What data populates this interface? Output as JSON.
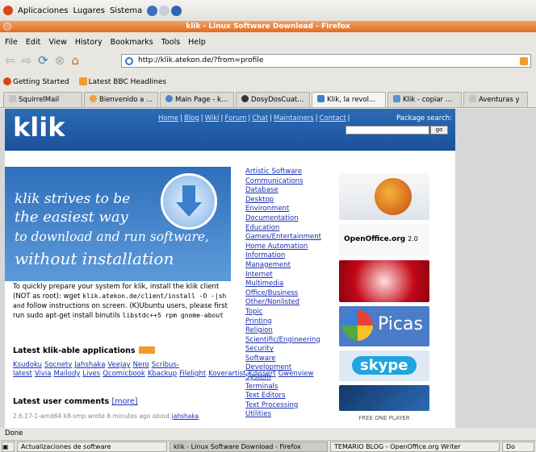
{
  "gnome_panel": {
    "menus": [
      "Aplicaciones",
      "Lugares",
      "Sistema"
    ]
  },
  "window": {
    "title": "klik - Linux Software Download - Firefox"
  },
  "menubar": [
    "File",
    "Edit",
    "View",
    "History",
    "Bookmarks",
    "Tools",
    "Help"
  ],
  "navigation": {
    "url": "http://klik.atekon.de/?from=profile"
  },
  "bookmarks": [
    "Getting Started",
    "Latest BBC Headlines"
  ],
  "tabs": [
    "SquirrelMail",
    "Bienvenido a ...",
    "Main Page - k...",
    "DosyDosCuat...",
    "Klik, la revol...",
    "Klik - copiar ...",
    "Aventuras y"
  ],
  "site": {
    "logo": "klik",
    "nav_links": [
      "Home",
      "Blog",
      "Wiki",
      "Forum",
      "Chat",
      "Maintainers",
      "Contact"
    ],
    "search_label": "Package search:",
    "go_label": "go",
    "banner_lines": [
      "klik strives to be",
      "the easiest way",
      "to download and run software,",
      "without installation"
    ],
    "intro_text": "To quickly prepare your system for klik, install the klik client (NOT as root): wget",
    "intro_code": "klik.atekon.de/client/install -O -|sh and",
    "intro_text2": "follow instructions on screen. (K)Ubuntu users, please first run sudo apt-get install binutils",
    "intro_code2": "libstdc++5 rpm gnome-about",
    "latest_apps_heading": "Latest klik-able applications",
    "latest_apps": [
      "Ksudoku",
      "Socnetv",
      "Jahshaka",
      "Veejay",
      "Nero",
      "Scribus-latest",
      "Vivia",
      "Mailody",
      "Lives",
      "Qcomicbook",
      "Kbackup",
      "Filelight",
      "Koverartist",
      "Kdissert",
      "Gwenview"
    ],
    "latest_comments_heading": "Latest user comments",
    "more_label": "[more]",
    "comment_text": "2.6.17-1-amd64 k8-smp wrote 6 minutes ago about",
    "comment_link": "jahshaka",
    "categories": [
      "Artistic Software",
      "Communications",
      "Database",
      "Desktop",
      "Environment",
      "Documentation",
      "Education",
      "Games/Entertainment",
      "Home Automation",
      "Information",
      "Management",
      "Internet",
      "Multimedia",
      "Office/Business",
      "Other/Nonlisted",
      "Topic",
      "Printing",
      "Religion",
      "Scientific/Engineering",
      "Security",
      "Software",
      "Development",
      "System",
      "Terminals",
      "Text Editors",
      "Text Processing",
      "Utilities"
    ],
    "logo_openoffice": "OpenOffice.org",
    "logo_openoffice_version": "2.0",
    "logo_picasa": "Picas",
    "logo_skype": "skype",
    "logo_freeone": "FREE ONE PLAYER"
  },
  "status_bar": {
    "text": "Done"
  },
  "taskbar": [
    "Actualizaciones de software",
    "klik - Linux Software Download - Firefox",
    "TEMARIO BLOG - OpenOffice.org Writer",
    "Do"
  ]
}
